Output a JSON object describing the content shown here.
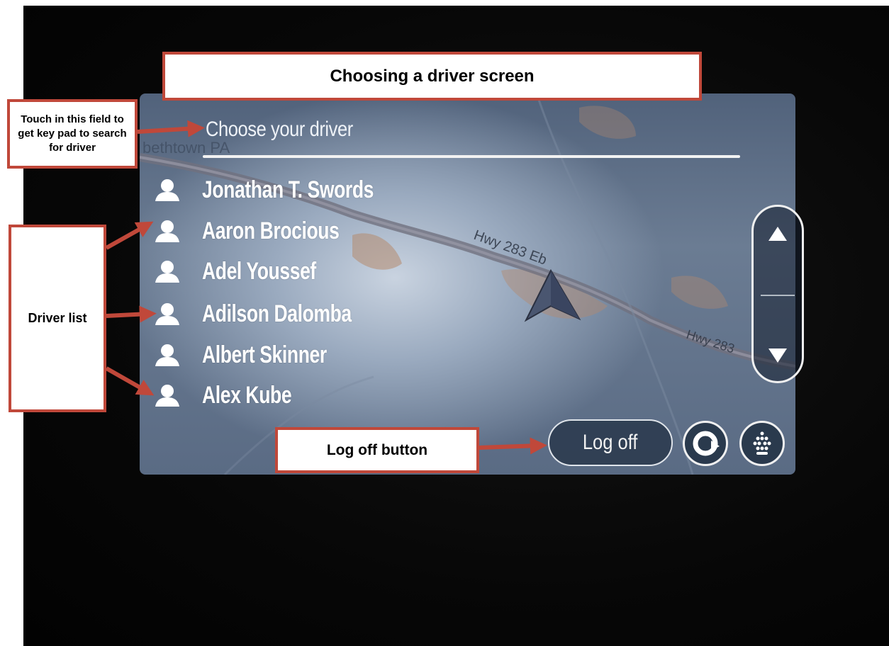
{
  "annotations": {
    "title": "Choosing a driver screen",
    "touch_field_note": "Touch in this field to get key pad to search for driver",
    "driver_list_note": "Driver list",
    "log_off_note": "Log off button"
  },
  "map": {
    "place_label": "bethtown PA",
    "road_label_1": "Hwy 283 Eb",
    "road_label_2": "Hwy 283"
  },
  "search": {
    "placeholder": "Choose your driver"
  },
  "drivers": [
    {
      "name": "Jonathan T. Swords"
    },
    {
      "name": "Aaron Brocious"
    },
    {
      "name": "Adel Youssef"
    },
    {
      "name": "Adilson Dalomba"
    },
    {
      "name": "Albert Skinner"
    },
    {
      "name": "Alex Kube"
    }
  ],
  "buttons": {
    "log_off": "Log off"
  },
  "icons": {
    "driver": "person-icon",
    "scroll_up": "arrow-up-icon",
    "scroll_down": "arrow-down-icon",
    "refresh": "refresh-icon",
    "keypad": "keypad-icon",
    "position": "navigation-arrow-icon"
  },
  "colors": {
    "annotation_border": "#c0483a",
    "annotation_arrow": "#c0483a",
    "screen_text": "#ffffff",
    "map_road": "#6e6e78",
    "map_area": "#b48a6e"
  }
}
